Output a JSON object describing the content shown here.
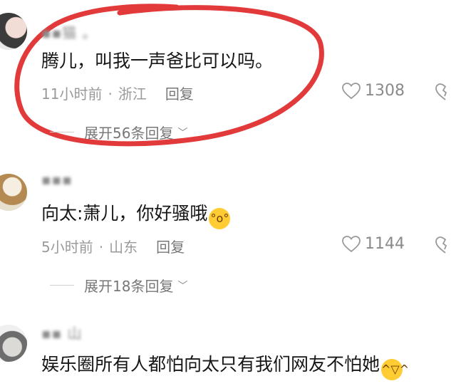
{
  "colors": {
    "annotation_circle": "#e23a3a",
    "text": "#161616",
    "meta": "#9a9a9a"
  },
  "comments": [
    {
      "username": "▪▪猫  。",
      "text": "腾儿，叫我一声爸比可以吗。",
      "time": "11小时前",
      "location": "浙江",
      "reply_label": "回复",
      "likes": "1308",
      "expand_label": "展开56条回复"
    },
    {
      "username": "▪▪▪",
      "text": "向太:萧儿，你好骚哦",
      "emoji_icon": "astonished-face-icon",
      "time": "5小时前",
      "location": "山东",
      "reply_label": "回复",
      "likes": "1144",
      "expand_label": "展开18条回复"
    },
    {
      "username": "▪▪ 山",
      "text": "娱乐圈所有人都怕向太只有我们网友不怕她",
      "emoji_icon": "rolling-laughing-face-icon"
    }
  ]
}
